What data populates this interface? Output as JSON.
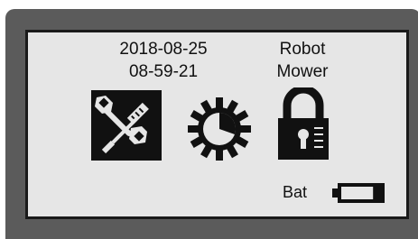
{
  "device": {
    "date": "2018-08-25",
    "time": "08-59-21",
    "name_line1": "Robot",
    "name_line2": "Mower",
    "battery_label": "Bat",
    "battery_level": 0.2,
    "icons": [
      "tools-icon",
      "settings-gear-icon",
      "lock-icon",
      "battery-icon"
    ]
  }
}
